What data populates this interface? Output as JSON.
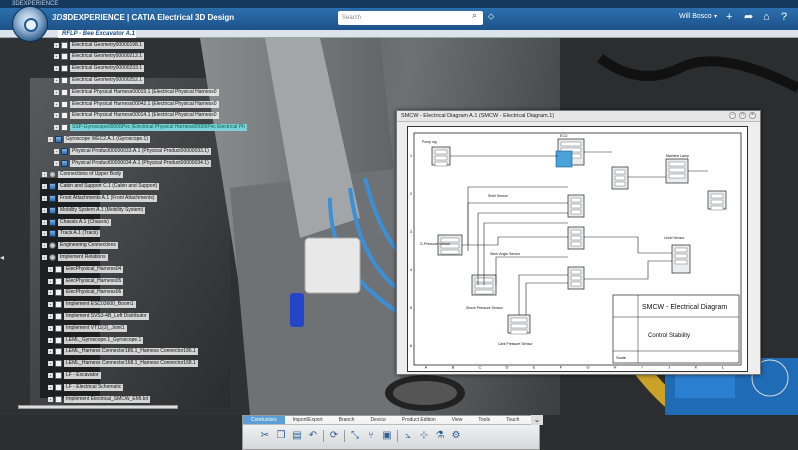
{
  "window": {
    "title": "3DEXPERIENCE"
  },
  "topbar": {
    "logo": "3DS",
    "brand": "3DEXPERIENCE | CATIA Electrical 3D Design",
    "search_placeholder": "Search",
    "user": "Will Bosco",
    "user_caret": "▾"
  },
  "tabs": [
    {
      "label": "RFLP - Bee Excavator A.1"
    }
  ],
  "tree": {
    "rows": [
      {
        "label": "Electrical Geometry00000198.1",
        "icon": "doc"
      },
      {
        "label": "Electrical Geometry00000212.1",
        "icon": "doc"
      },
      {
        "label": "Electrical Geometry00000233.1",
        "icon": "doc"
      },
      {
        "label": "Electrical Geometry00000252.1",
        "icon": "doc"
      },
      {
        "label": "Electrical Physical Harness00019.1 (Electrical Physical Harness0",
        "icon": "doc"
      },
      {
        "label": "Electrical Physical Harness00042.1 (Electrical Physical Harness0",
        "icon": "doc"
      },
      {
        "label": "Electrical Physical Harness00014.1 (Electrical Physical Harness0",
        "icon": "doc"
      },
      {
        "label": "SSP-Gyroscope00005Pvc (Electrical Physical Harness00006Pvc Electrical Ph",
        "icon": "doc"
      },
      {
        "label": "Gyroscope WEC2.A.1 (Gyroscope.1)",
        "icon": "prod"
      },
      {
        "label": "Physical Product00000033.A.1 (Physical Product00000033.1)",
        "icon": "prod"
      },
      {
        "label": "Physical Product00000034.A.1 (Physical Product00000034.1)",
        "icon": "prod"
      },
      {
        "label": "Connections of Upper Body",
        "icon": "gear"
      },
      {
        "label": "Cabin and Support C.1 (Cabin and Support)",
        "icon": "prod"
      },
      {
        "label": "Front Attachments A.1 (Front Attachments)",
        "icon": "prod"
      },
      {
        "label": "Mobility System A.1 (Mobility System)",
        "icon": "prod"
      },
      {
        "label": "Chassis A.1 (Chassis)",
        "icon": "prod"
      },
      {
        "label": "Track A.1 (Track)",
        "icon": "prod"
      },
      {
        "label": "Engineering Connections",
        "icon": "gear"
      },
      {
        "label": "Implement Relations",
        "icon": "gear"
      },
      {
        "label": "ElecPhysical_Harness04",
        "icon": "doc"
      },
      {
        "label": "ElecPhysical_Harness05",
        "icon": "doc"
      },
      {
        "label": "ElecPhysical_Harness06",
        "icon": "doc"
      },
      {
        "label": "Implement ESC03600_Boom1",
        "icon": "doc"
      },
      {
        "label": "Implement SVS3-4B_Left Distributor",
        "icon": "doc"
      },
      {
        "label": "Implement VT11(2)_Joint1",
        "icon": "doc"
      },
      {
        "label": "LEML_Gyroscope.1_Gyroscope.1",
        "icon": "doc"
      },
      {
        "label": "LEML_Harness Connector186.1_Harness Connector186.1",
        "icon": "doc"
      },
      {
        "label": "LEML_Harness Connector168.1_Harness Connector168.1",
        "icon": "doc"
      },
      {
        "label": "LF - Excavator",
        "icon": "doc"
      },
      {
        "label": "LF - Electrical Schematic",
        "icon": "doc"
      },
      {
        "label": "Implement Electrical_SMCW_EMI.bit",
        "icon": "doc"
      }
    ]
  },
  "diagram": {
    "window_title": "SMCW - Electrical Diagram A.1 (SMCW - Electrical Diagram.1)",
    "title_block": {
      "title": "SMCW - Electrical Diagram",
      "subtitle": "Control Stability",
      "scale_label": "Scale"
    },
    "components": [
      "Pump sig",
      "ECU",
      "Machine Lamp",
      "G-Pressure Sensor",
      "Shock Pressure Sensor",
      "Jet Pressure Sensor",
      "Level Sensor",
      "Cant Pressure Sensor",
      "Steer Angle Sensor",
      "Shell Sensor"
    ],
    "border_letters": [
      "A",
      "B",
      "C",
      "D",
      "E",
      "F",
      "G",
      "H",
      "I",
      "J",
      "K",
      "L"
    ],
    "border_numbers": [
      "1",
      "2",
      "3",
      "4",
      "5",
      "6"
    ]
  },
  "action_bar": {
    "tabs": [
      "Conductors",
      "Import/Export",
      "Branch",
      "Device",
      "Product Edition",
      "View",
      "Tools",
      "Touch"
    ],
    "active_tab": "Conductors",
    "more": "⌄"
  },
  "colors": {
    "topbar": "#1d5289",
    "selected": "#7fd0dc",
    "active_tab": "#5b9fd6",
    "device_box": "#e9edf0"
  }
}
